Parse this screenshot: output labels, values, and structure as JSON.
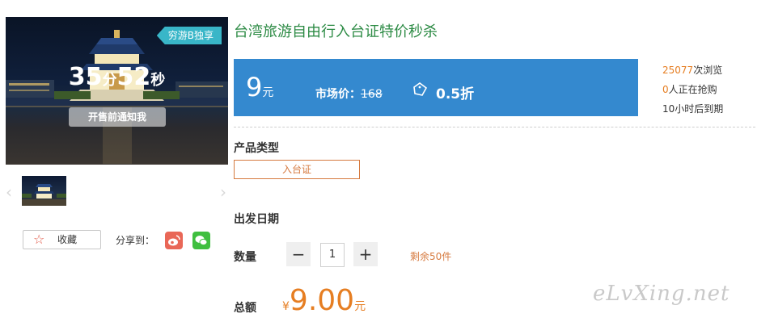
{
  "product": {
    "title": "台湾旅游自由行入台证特价秒杀",
    "promo_tag": "穷游B独享"
  },
  "countdown": {
    "minutes": "35",
    "minutes_unit": "分",
    "seconds": "52",
    "seconds_unit": "秒",
    "notify_label": "开售前通知我"
  },
  "price": {
    "value": "9",
    "unit": "元",
    "market_label": "市场价：",
    "market_value": "168",
    "discount": "0.5折"
  },
  "stats": {
    "views_count": "25077",
    "views_label": "次浏览",
    "buyers_count": "0",
    "buyers_label": "人正在抢购",
    "expiry": "10小时后到期"
  },
  "gallery": {
    "prev_arrow": "‹",
    "next_arrow": "›"
  },
  "actions": {
    "favorite_label": "收藏",
    "share_label": "分享到："
  },
  "options": {
    "type_label": "产品类型",
    "type_value": "入台证",
    "date_label": "出发日期",
    "qty_label": "数量",
    "qty_minus": "−",
    "qty_value": "1",
    "qty_plus": "+",
    "remaining": "剩余50件"
  },
  "total": {
    "label": "总额",
    "symbol": "¥",
    "amount": "9.00",
    "unit": "元"
  },
  "watermark": "eLvXing.net",
  "colors": {
    "title_green": "#2d8b45",
    "price_blue": "#3489cf",
    "accent_orange": "#e67e22",
    "promo_teal": "#39b6c8",
    "weibo_red": "#e96757",
    "wechat_green": "#3fbf3f"
  },
  "icons": [
    "star-icon",
    "weibo-icon",
    "wechat-icon",
    "tag-icon"
  ]
}
